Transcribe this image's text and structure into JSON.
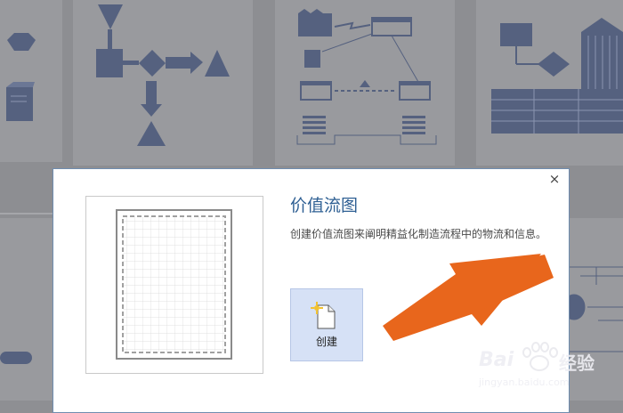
{
  "dialog": {
    "title": "价值流图",
    "description": "创建价值流图来阐明精益化制造流程中的物流和信息。",
    "close_symbol": "×",
    "create_label": "创建"
  },
  "watermark": {
    "brand": "Bai",
    "brand_cn": "经验",
    "url": "jingyan.baidu.com"
  },
  "colors": {
    "accent": "#2e5f93",
    "button_bg": "#d6e1f6",
    "arrow": "#e8661c",
    "shape_fill": "#55617f"
  },
  "icons": [
    "close-icon",
    "new-document-icon",
    "orange-arrow"
  ]
}
